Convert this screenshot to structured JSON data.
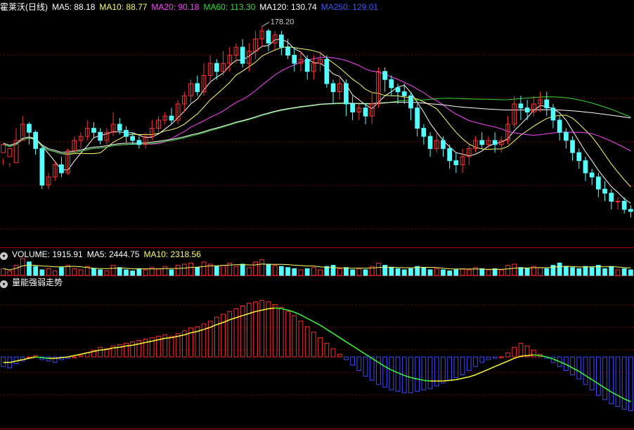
{
  "stock_title": "霍莱沃(日线)",
  "price_header": [
    {
      "label": "MA5: 88.18",
      "color": "#ffffff"
    },
    {
      "label": "MA10: 88.77",
      "color": "#ffff66"
    },
    {
      "label": "MA20: 90.18",
      "color": "#ff44ff"
    },
    {
      "label": "MA60: 113.30",
      "color": "#33dd33"
    },
    {
      "label": "MA120: 130.74",
      "color": "#ffffff"
    },
    {
      "label": "MA250: 129.01",
      "color": "#3a5bff"
    }
  ],
  "volume_header": [
    {
      "label": "VOLUME: 1915.91",
      "color": "#ffffff"
    },
    {
      "label": "MA5: 2444.75",
      "color": "#ffffff"
    },
    {
      "label": "MA10: 2318.56",
      "color": "#ffff66"
    }
  ],
  "indicator_header": {
    "label": "量能强弱走势",
    "color": "#ffffff"
  },
  "high_marker": "178.20",
  "colors": {
    "up": "#ff3232",
    "down": "#54ffff",
    "bg": "#000000",
    "divider": "#aa0000",
    "grid": "#7a0000",
    "ma5": "#ffffff",
    "ma10": "#ffff66",
    "ma20": "#ff44ff",
    "ma60": "#33dd33",
    "ma120": "#ffffff",
    "ind_up": "#ff2a2a",
    "ind_down": "#3a4bff",
    "ind_line_up": "#ffff33",
    "ind_line_down": "#33ff33"
  },
  "chart_data": {
    "type": "candlestick",
    "y_range": [
      70,
      185
    ],
    "high_value": 178.2,
    "ohlc": [
      [
        116,
        120,
        113,
        110
      ],
      [
        114,
        118,
        111,
        109
      ],
      [
        111,
        122,
        128,
        122
      ],
      [
        122,
        130,
        134,
        124
      ],
      [
        130,
        126,
        131,
        120
      ],
      [
        126,
        118,
        127,
        115
      ],
      [
        118,
        100,
        120,
        98
      ],
      [
        100,
        104,
        106,
        98
      ],
      [
        104,
        110,
        112,
        102
      ],
      [
        110,
        106,
        114,
        104
      ],
      [
        106,
        117,
        118,
        105
      ],
      [
        117,
        122,
        124,
        115
      ],
      [
        122,
        124,
        126,
        118
      ],
      [
        124,
        128,
        132,
        122
      ],
      [
        128,
        126,
        131,
        123
      ],
      [
        126,
        122,
        128,
        120
      ],
      [
        122,
        126,
        128,
        120
      ],
      [
        126,
        130,
        136,
        124
      ],
      [
        130,
        127,
        133,
        125
      ],
      [
        127,
        124,
        129,
        121
      ],
      [
        124,
        122,
        126,
        120
      ],
      [
        122,
        120,
        124,
        118
      ],
      [
        120,
        124,
        126,
        118
      ],
      [
        124,
        128,
        132,
        122
      ],
      [
        128,
        132,
        134,
        126
      ],
      [
        132,
        134,
        136,
        130
      ],
      [
        134,
        132,
        138,
        130
      ],
      [
        132,
        140,
        142,
        130
      ],
      [
        140,
        144,
        146,
        136
      ],
      [
        144,
        150,
        152,
        140
      ],
      [
        150,
        146,
        154,
        144
      ],
      [
        146,
        154,
        160,
        144
      ],
      [
        154,
        160,
        164,
        150
      ],
      [
        160,
        156,
        162,
        152
      ],
      [
        156,
        160,
        166,
        154
      ],
      [
        160,
        164,
        168,
        156
      ],
      [
        164,
        168,
        170,
        160
      ],
      [
        168,
        160,
        172,
        158
      ],
      [
        160,
        166,
        170,
        156
      ],
      [
        166,
        172,
        176,
        162
      ],
      [
        172,
        176,
        178.2,
        168
      ],
      [
        176,
        170,
        177,
        166
      ],
      [
        170,
        174,
        176,
        166
      ],
      [
        174,
        168,
        176,
        164
      ],
      [
        168,
        164,
        172,
        162
      ],
      [
        164,
        160,
        168,
        156
      ],
      [
        160,
        162,
        166,
        156
      ],
      [
        162,
        156,
        164,
        152
      ],
      [
        156,
        160,
        164,
        152
      ],
      [
        160,
        162,
        166,
        156
      ],
      [
        162,
        150,
        164,
        148
      ],
      [
        150,
        146,
        152,
        140
      ],
      [
        146,
        150,
        154,
        142
      ],
      [
        150,
        140,
        152,
        134
      ],
      [
        140,
        136,
        144,
        132
      ],
      [
        136,
        138,
        140,
        132
      ],
      [
        138,
        134,
        140,
        130
      ],
      [
        134,
        140,
        146,
        130
      ],
      [
        140,
        156,
        158,
        138
      ],
      [
        156,
        152,
        158,
        146
      ],
      [
        152,
        148,
        154,
        144
      ],
      [
        148,
        146,
        150,
        140
      ],
      [
        146,
        144,
        150,
        140
      ],
      [
        144,
        138,
        146,
        132
      ],
      [
        138,
        128,
        140,
        124
      ],
      [
        128,
        124,
        130,
        120
      ],
      [
        124,
        118,
        126,
        114
      ],
      [
        118,
        122,
        126,
        116
      ],
      [
        122,
        118,
        124,
        114
      ],
      [
        118,
        112,
        120,
        108
      ],
      [
        112,
        110,
        116,
        106
      ],
      [
        110,
        114,
        118,
        106
      ],
      [
        114,
        118,
        120,
        110
      ],
      [
        118,
        122,
        124,
        116
      ],
      [
        122,
        120,
        126,
        118
      ],
      [
        120,
        122,
        124,
        118
      ],
      [
        122,
        120,
        126,
        116
      ],
      [
        120,
        122,
        124,
        116
      ],
      [
        122,
        130,
        134,
        120
      ],
      [
        130,
        140,
        144,
        128
      ],
      [
        140,
        138,
        144,
        132
      ],
      [
        138,
        136,
        142,
        132
      ],
      [
        136,
        140,
        144,
        134
      ],
      [
        140,
        142,
        146,
        136
      ],
      [
        142,
        138,
        146,
        134
      ],
      [
        138,
        132,
        140,
        128
      ],
      [
        132,
        126,
        134,
        122
      ],
      [
        126,
        122,
        128,
        118
      ],
      [
        122,
        116,
        124,
        112
      ],
      [
        116,
        112,
        118,
        108
      ],
      [
        112,
        106,
        114,
        102
      ],
      [
        106,
        104,
        108,
        100
      ],
      [
        104,
        98,
        106,
        94
      ],
      [
        98,
        96,
        102,
        92
      ],
      [
        96,
        92,
        98,
        88
      ],
      [
        92,
        92,
        94,
        88
      ],
      [
        92,
        88,
        94,
        86
      ],
      [
        88,
        87,
        90,
        84
      ]
    ],
    "volume": [
      0.6,
      0.4,
      0.9,
      1.5,
      1.2,
      0.8,
      0.5,
      0.6,
      0.4,
      0.7,
      0.9,
      0.6,
      0.5,
      0.8,
      0.6,
      0.5,
      0.4,
      0.9,
      0.7,
      0.5,
      0.4,
      0.6,
      0.5,
      0.7,
      0.6,
      0.8,
      0.5,
      0.9,
      1.0,
      1.1,
      0.7,
      1.2,
      1.0,
      0.8,
      0.9,
      1.1,
      0.8,
      1.0,
      0.7,
      1.2,
      1.4,
      1.0,
      0.9,
      0.8,
      0.7,
      0.6,
      0.5,
      0.6,
      0.7,
      0.5,
      0.8,
      0.9,
      0.6,
      0.7,
      0.5,
      0.6,
      0.5,
      0.8,
      1.1,
      0.9,
      0.7,
      0.6,
      0.5,
      0.6,
      0.8,
      0.7,
      0.5,
      0.6,
      0.5,
      0.4,
      0.5,
      0.6,
      0.5,
      0.7,
      0.6,
      0.5,
      0.6,
      0.5,
      0.9,
      1.0,
      0.7,
      0.6,
      0.8,
      0.7,
      0.6,
      0.9,
      1.1,
      0.8,
      0.7,
      0.6,
      0.8,
      0.7,
      0.9,
      0.6,
      0.8,
      0.5,
      0.6,
      0.5
    ],
    "indicator_range": [
      -100,
      100
    ],
    "indicator": [
      -14,
      -16,
      -10,
      -6,
      0,
      2,
      -4,
      -6,
      -8,
      -4,
      -2,
      0,
      2,
      6,
      10,
      14,
      12,
      16,
      18,
      20,
      22,
      24,
      26,
      28,
      30,
      32,
      30,
      34,
      38,
      42,
      44,
      48,
      52,
      58,
      62,
      66,
      70,
      74,
      78,
      80,
      82,
      80,
      76,
      72,
      66,
      60,
      52,
      44,
      36,
      28,
      20,
      12,
      4,
      -4,
      -12,
      -20,
      -28,
      -34,
      -40,
      -44,
      -48,
      -50,
      -52,
      -52,
      -50,
      -48,
      -46,
      -42,
      -38,
      -34,
      -30,
      -26,
      -20,
      -14,
      -8,
      -4,
      -2,
      0,
      6,
      14,
      20,
      16,
      10,
      4,
      -2,
      -8,
      -14,
      -20,
      -26,
      -32,
      -40,
      -48,
      -56,
      -62,
      -68,
      -72,
      -76,
      -78
    ],
    "indicator_line": [
      -8,
      -8,
      -6,
      -4,
      -2,
      0,
      -1,
      -2,
      -2,
      -1,
      0,
      2,
      4,
      6,
      8,
      10,
      11,
      13,
      14,
      16,
      17,
      19,
      21,
      23,
      25,
      27,
      28,
      30,
      32,
      35,
      37,
      40,
      43,
      47,
      50,
      54,
      57,
      60,
      63,
      66,
      68,
      70,
      71,
      70,
      68,
      65,
      61,
      56,
      51,
      46,
      40,
      34,
      28,
      22,
      16,
      10,
      4,
      -2,
      -8,
      -14,
      -19,
      -23,
      -27,
      -30,
      -32,
      -34,
      -35,
      -35,
      -35,
      -34,
      -33,
      -31,
      -29,
      -26,
      -22,
      -18,
      -14,
      -10,
      -6,
      -2,
      1,
      2,
      3,
      2,
      0,
      -3,
      -7,
      -11,
      -16,
      -21,
      -27,
      -33,
      -39,
      -45,
      -51,
      -56,
      -61,
      -65
    ]
  }
}
